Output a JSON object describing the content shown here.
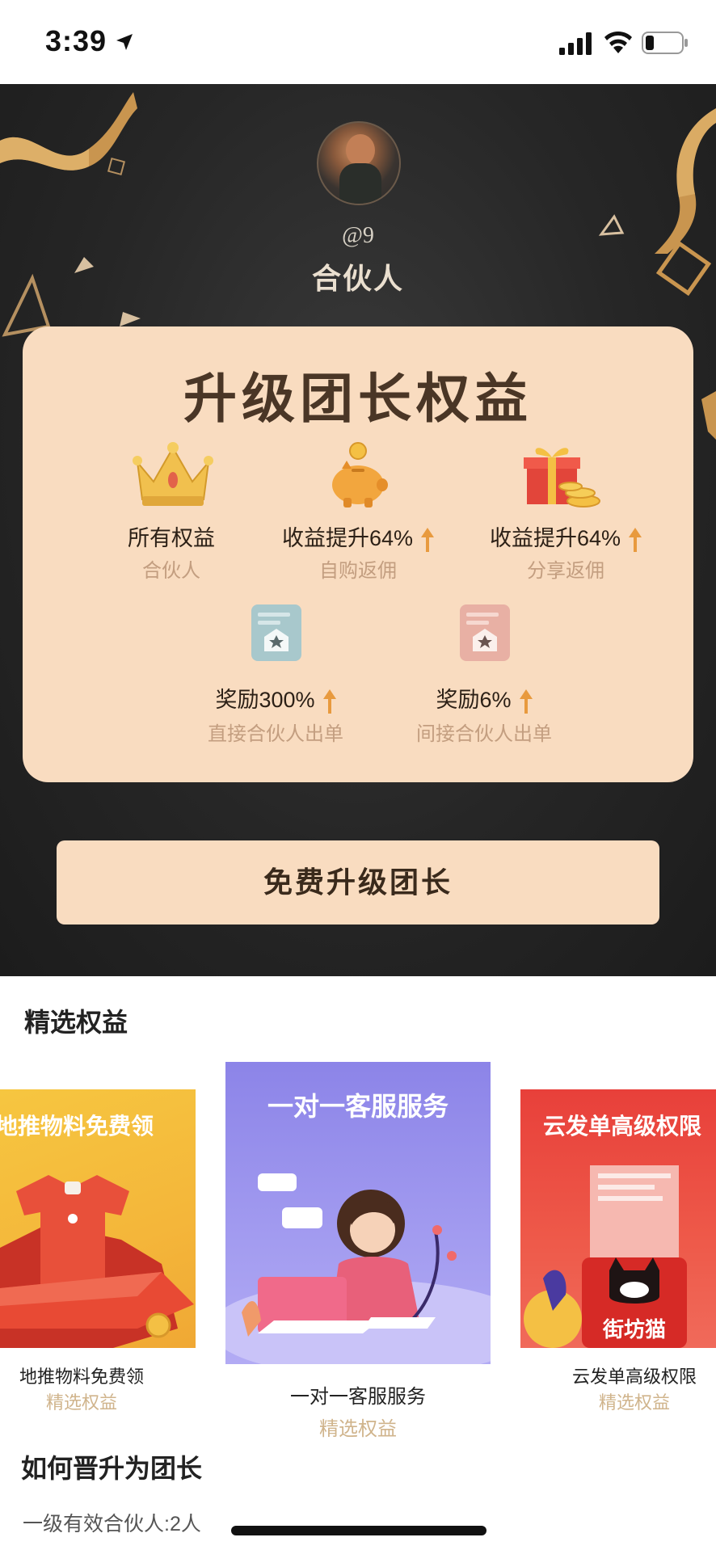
{
  "status_bar": {
    "time": "3:39"
  },
  "profile": {
    "handle": "@9",
    "role": "合伙人"
  },
  "benefits_card": {
    "title": "升级团长权益",
    "items": [
      {
        "main": "所有权益",
        "sub": "合伙人",
        "icon": "crown-icon",
        "arrow": false
      },
      {
        "main": "收益提升64%",
        "sub": "自购返佣",
        "icon": "piggy-bank-icon",
        "arrow": true
      },
      {
        "main": "收益提升64%",
        "sub": "分享返佣",
        "icon": "gift-box-icon",
        "arrow": true
      },
      {
        "main": "奖励300%",
        "sub": "直接合伙人出单",
        "icon": "partner-badge-icon",
        "arrow": true
      },
      {
        "main": "奖励6%",
        "sub": "间接合伙人出单",
        "icon": "partner-badge-icon",
        "arrow": true
      }
    ]
  },
  "upgrade_button": {
    "label": "免费升级团长"
  },
  "featured": {
    "title": "精选权益",
    "cards": [
      {
        "banner": "地推物料免费领",
        "caption": "地推物料免费领",
        "sub": "精选权益"
      },
      {
        "banner": "一对一客服服务",
        "caption": "一对一客服服务",
        "sub": "精选权益"
      },
      {
        "banner": "云发单高级权限",
        "caption": "云发单高级权限",
        "sub": "精选权益"
      }
    ]
  },
  "promotion": {
    "title": "如何晋升为团长",
    "requirement": "一级有效合伙人:2人"
  },
  "colors": {
    "card_bg": "#f9dcc0",
    "hero_bg": "#262626",
    "accent_gold": "#e8a24a",
    "muted_gold": "#d0b48c"
  }
}
